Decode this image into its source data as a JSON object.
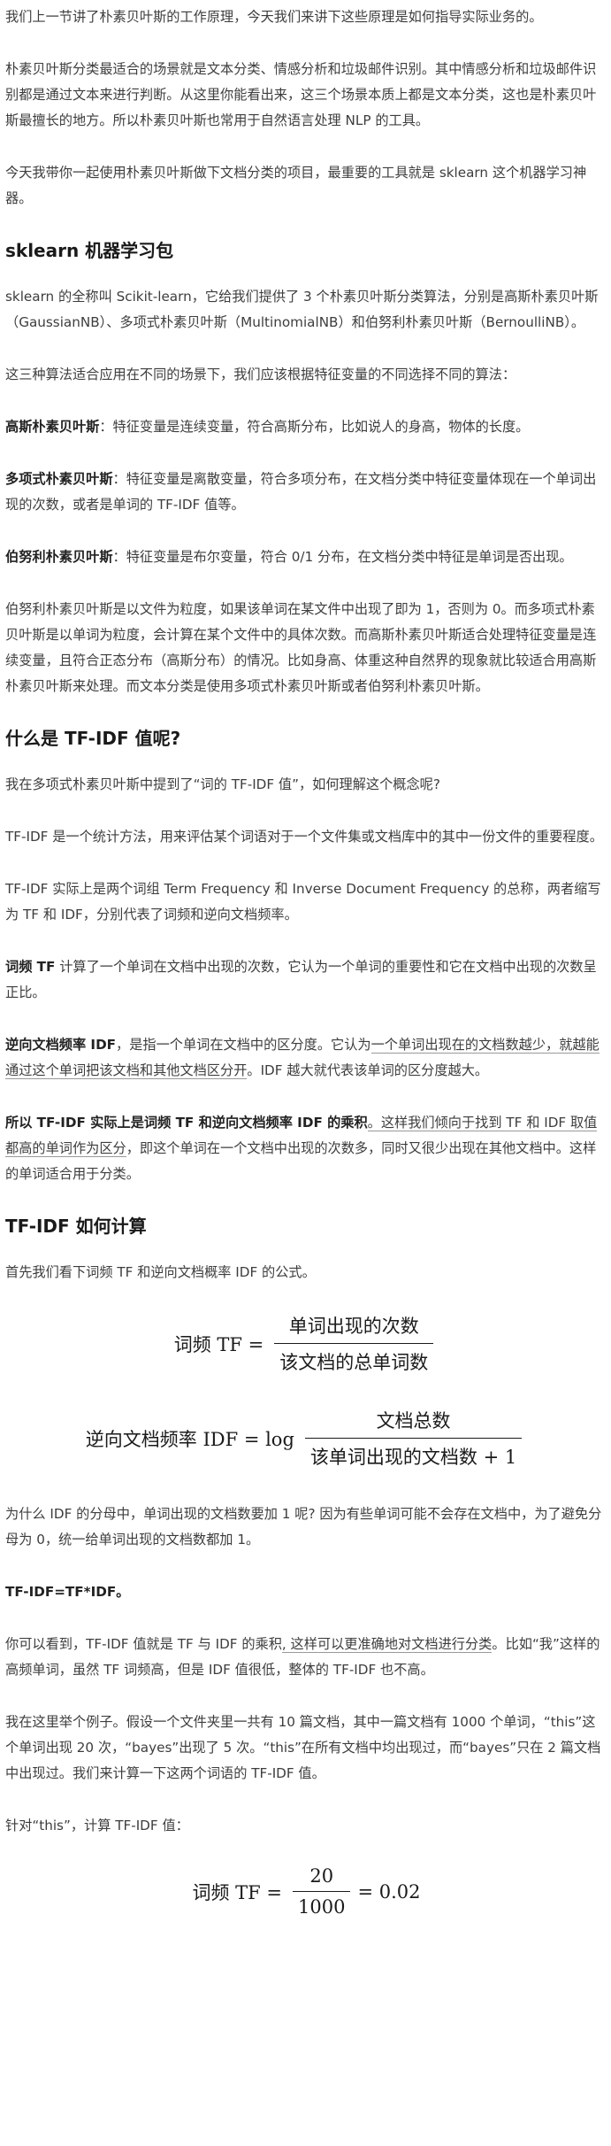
{
  "paragraphs": {
    "p1": "我们上一节讲了朴素贝叶斯的工作原理，今天我们来讲下这些原理是如何指导实际业务的。",
    "p2": "朴素贝叶斯分类最适合的场景就是文本分类、情感分析和垃圾邮件识别。其中情感分析和垃圾邮件识别都是通过文本来进行判断。从这里你能看出来，这三个场景本质上都是文本分类，这也是朴素贝叶斯最擅长的地方。所以朴素贝叶斯也常用于自然语言处理 NLP 的工具。",
    "p3": "今天我带你一起使用朴素贝叶斯做下文档分类的项目，最重要的工具就是 sklearn 这个机器学习神器。"
  },
  "section1": {
    "heading": "sklearn 机器学习包",
    "intro": "sklearn 的全称叫 Scikit-learn，它给我们提供了 3 个朴素贝叶斯分类算法，分别是高斯朴素贝叶斯（GaussianNB）、多项式朴素贝叶斯（MultinomialNB）和伯努利朴素贝叶斯（BernoulliNB）。",
    "choose": "这三种算法适合应用在不同的场景下，我们应该根据特征变量的不同选择不同的算法：",
    "gaussian_term": "高斯朴素贝叶斯",
    "gaussian_desc": "：特征变量是连续变量，符合高斯分布，比如说人的身高，物体的长度。",
    "multinomial_term": "多项式朴素贝叶斯",
    "multinomial_desc": "：特征变量是离散变量，符合多项分布，在文档分类中特征变量体现在一个单词出现的次数，或者是单词的 TF-IDF 值等。",
    "bernoulli_term": "伯努利朴素贝叶斯",
    "bernoulli_desc": "：特征变量是布尔变量，符合 0/1 分布，在文档分类中特征是单词是否出现。",
    "summary": "伯努利朴素贝叶斯是以文件为粒度，如果该单词在某文件中出现了即为 1，否则为 0。而多项式朴素贝叶斯是以单词为粒度，会计算在某个文件中的具体次数。而高斯朴素贝叶斯适合处理特征变量是连续变量，且符合正态分布（高斯分布）的情况。比如身高、体重这种自然界的现象就比较适合用高斯朴素贝叶斯来处理。而文本分类是使用多项式朴素贝叶斯或者伯努利朴素贝叶斯。"
  },
  "section2": {
    "heading": "什么是 TF-IDF 值呢?",
    "q": "我在多项式朴素贝叶斯中提到了“词的 TF-IDF 值”，如何理解这个概念呢?",
    "def": "TF-IDF 是一个统计方法，用来评估某个词语对于一个文件集或文档库中的其中一份文件的重要程度。",
    "abbr": "TF-IDF 实际上是两个词组 Term Frequency 和 Inverse Document Frequency 的总称，两者缩写为 TF 和 IDF，分别代表了词频和逆向文档频率。",
    "tf_term": "词频 TF",
    "tf_desc": " 计算了一个单词在文档中出现的次数，它认为一个单词的重要性和它在文档中出现的次数呈正比。",
    "idf_term": "逆向文档频率 IDF",
    "idf_desc_a": "，是指一个单词在文档中的区分度。它认为",
    "idf_desc_u": "一个单词出现在的文档数越少，就越能通过这个单词把该文档和其他文档区分开",
    "idf_desc_b": "。IDF 越大就代表该单词的区分度越大。",
    "product_term": "所以 TF-IDF 实际上是词频 TF 和逆向文档频率 IDF 的乘积",
    "product_desc_u": "。这样我们倾向于找到 TF 和 IDF 取值都高的单词作为区分",
    "product_desc_b": "，即这个单词在一个文档中出现的次数多，同时又很少出现在其他文档中。这样的单词适合用于分类。"
  },
  "section3": {
    "heading": "TF-IDF 如何计算",
    "intro": "首先我们看下词频 TF 和逆向文档概率 IDF 的公式。",
    "formula_tf": {
      "lhs": "词频 TF =",
      "num": "单词出现的次数",
      "den": "该文档的总单词数"
    },
    "formula_idf": {
      "lhs": "逆向文档频率 IDF = log",
      "num": "文档总数",
      "den": "该单词出现的文档数 + 1"
    },
    "why": "为什么 IDF 的分母中，单词出现的文档数要加 1 呢? 因为有些单词可能不会存在文档中，为了避免分母为 0，统一给单词出现的文档数都加 1。",
    "product_formula": "TF-IDF=TF*IDF。",
    "explain_a": "你可以看到，TF-IDF 值就是 TF 与 IDF 的乘积",
    "explain_u": ", 这样可以更准确地对文档进行分类",
    "explain_b": "。比如“我”这样的高频单词，虽然 TF 词频高，但是 IDF 值很低，整体的 TF-IDF 也不高。",
    "example": "我在这里举个例子。假设一个文件夹里一共有 10 篇文档，其中一篇文档有 1000 个单词，“this”这个单词出现 20 次，“bayes”出现了 5 次。“this”在所有文档中均出现过，而“bayes”只在 2 篇文档中出现过。我们来计算一下这两个词语的 TF-IDF 值。",
    "for_this": "针对“this”，计算 TF-IDF 值：",
    "formula_this": {
      "lhs": "词频 TF =",
      "num": "20",
      "den": "1000",
      "result": "= 0.02"
    }
  }
}
